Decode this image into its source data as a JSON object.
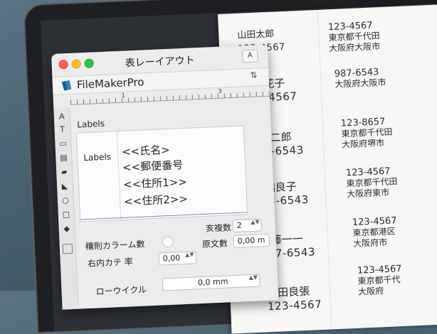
{
  "window": {
    "title": "表レーイアウト",
    "toolbar_button_label": "A"
  },
  "app_bar": {
    "brand": "FileMakerPro",
    "arrows": "⇅"
  },
  "ruler": {
    "numbers": [
      "1",
      "3"
    ]
  },
  "layout": {
    "section_label": "Labels",
    "part_label": "Labels",
    "fields": [
      "<<氏名>",
      "<<郵便番号",
      "<<住所1>>",
      "<<住所2>>"
    ]
  },
  "properties": {
    "rows_label": "亥複数",
    "rows_value": "2",
    "column_label": "穰則カラーム數",
    "spacing_label": "原文數",
    "spacing_value": "0,00 m",
    "margin_label": "右内カテ 率",
    "margin_value": "0,00",
    "row_label": "ローウイクル",
    "row_value": "0,0 mm",
    "spin_arrows": "▲▼"
  },
  "toolstrip_icons": [
    "A",
    "T",
    "▭",
    "▤",
    "▰",
    "◣",
    "○",
    "□",
    "◆"
  ],
  "document_labels": {
    "left": [
      {
        "name": "山田太郎",
        "zip": "123-4567"
      },
      {
        "name": "鈴木花子",
        "zip": "123-4567"
      },
      {
        "name": "佐藤二郎",
        "zip": "987-6543"
      },
      {
        "name": "高橋良子",
        "zip": "123-6543"
      },
      {
        "name": "伊藤一一",
        "zip": "987-6543"
      },
      {
        "name": "大田良張",
        "zip": "123-4567"
      }
    ],
    "right": [
      {
        "zip": "123-4567",
        "line1": "東京都千代田",
        "line2": "大阪府大阪市"
      },
      {
        "zip": "987-6543",
        "line1": "大阪府大阪市",
        "line2": ""
      },
      {
        "zip": "123-8657",
        "line1": "東京都千代田",
        "line2": "大阪府堺市"
      },
      {
        "zip": "123-4567",
        "line1": "東京都千代田",
        "line2": "大阪府東市"
      },
      {
        "zip": "123-4567",
        "line1": "東京都港区",
        "line2": "大阪府市"
      },
      {
        "zip": "123-4567",
        "line1": "東京都千代",
        "line2": "大阪府"
      }
    ]
  }
}
